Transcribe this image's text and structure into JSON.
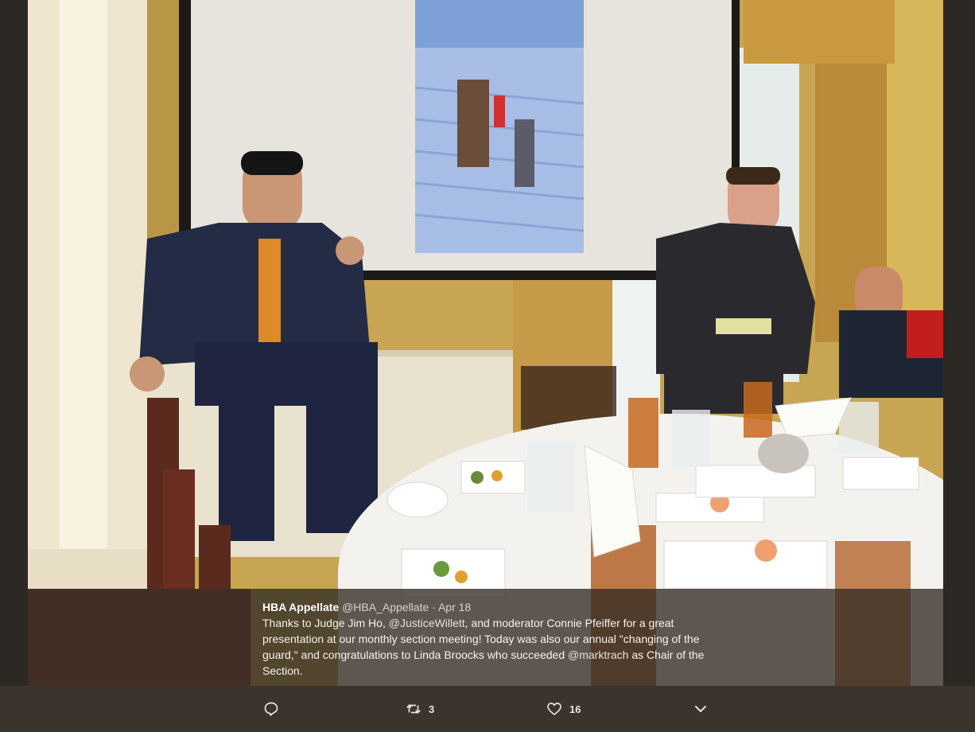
{
  "tweet": {
    "display_name": "HBA Appellate",
    "handle": "@HBA_Appellate",
    "separator": "·",
    "date": "Apr 18",
    "text_1": "Thanks to Judge Jim Ho, ",
    "mention_1": "@JusticeWillett",
    "text_2": ", and moderator Connie Pfeiffer for a great presentation at our monthly section meeting!  Today was also our annual \"changing of the guard,\" and congratulations to Linda Broocks who succeeded ",
    "mention_2": "@marktrach",
    "text_3": " as Chair of the Section."
  },
  "actions": {
    "reply": {
      "icon": "reply-icon"
    },
    "retweet": {
      "icon": "retweet-icon",
      "count": "3"
    },
    "like": {
      "icon": "heart-icon",
      "count": "16"
    },
    "more": {
      "icon": "chevron-down-icon"
    }
  },
  "colors": {
    "background": "#3a342c",
    "caption_overlay": "rgba(50,44,36,0.78)",
    "caption_text": "#f5f2ec"
  }
}
